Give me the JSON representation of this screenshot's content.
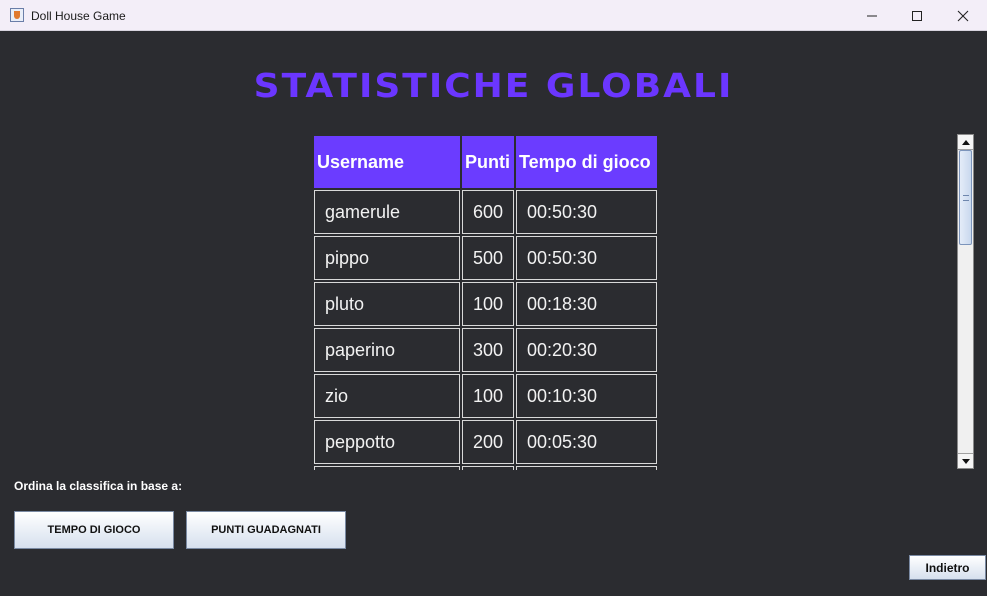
{
  "window": {
    "title": "Doll House Game",
    "controls": {
      "minimize_icon": "minimize-icon",
      "maximize_icon": "maximize-icon",
      "close_icon": "close-icon"
    }
  },
  "page": {
    "heading": "STATISTICHE GLOBALI",
    "heading_color": "#6b36ff"
  },
  "table": {
    "header_color": "#6b3cff",
    "columns": [
      "Username",
      "Punti",
      "Tempo di gioco"
    ],
    "rows": [
      {
        "username": "gamerule",
        "points": "600",
        "time": "00:50:30"
      },
      {
        "username": "pippo",
        "points": "500",
        "time": "00:50:30"
      },
      {
        "username": "pluto",
        "points": "100",
        "time": "00:18:30"
      },
      {
        "username": "paperino",
        "points": "300",
        "time": "00:20:30"
      },
      {
        "username": "zio",
        "points": "100",
        "time": "00:10:30"
      },
      {
        "username": "peppotto",
        "points": "200",
        "time": "00:05:30"
      }
    ]
  },
  "sorting": {
    "label": "Ordina la classifica in base a:",
    "by_time_label": "TEMPO DI GIOCO",
    "by_points_label": "PUNTI GUADAGNATI"
  },
  "footer": {
    "back_label": "Indietro"
  }
}
